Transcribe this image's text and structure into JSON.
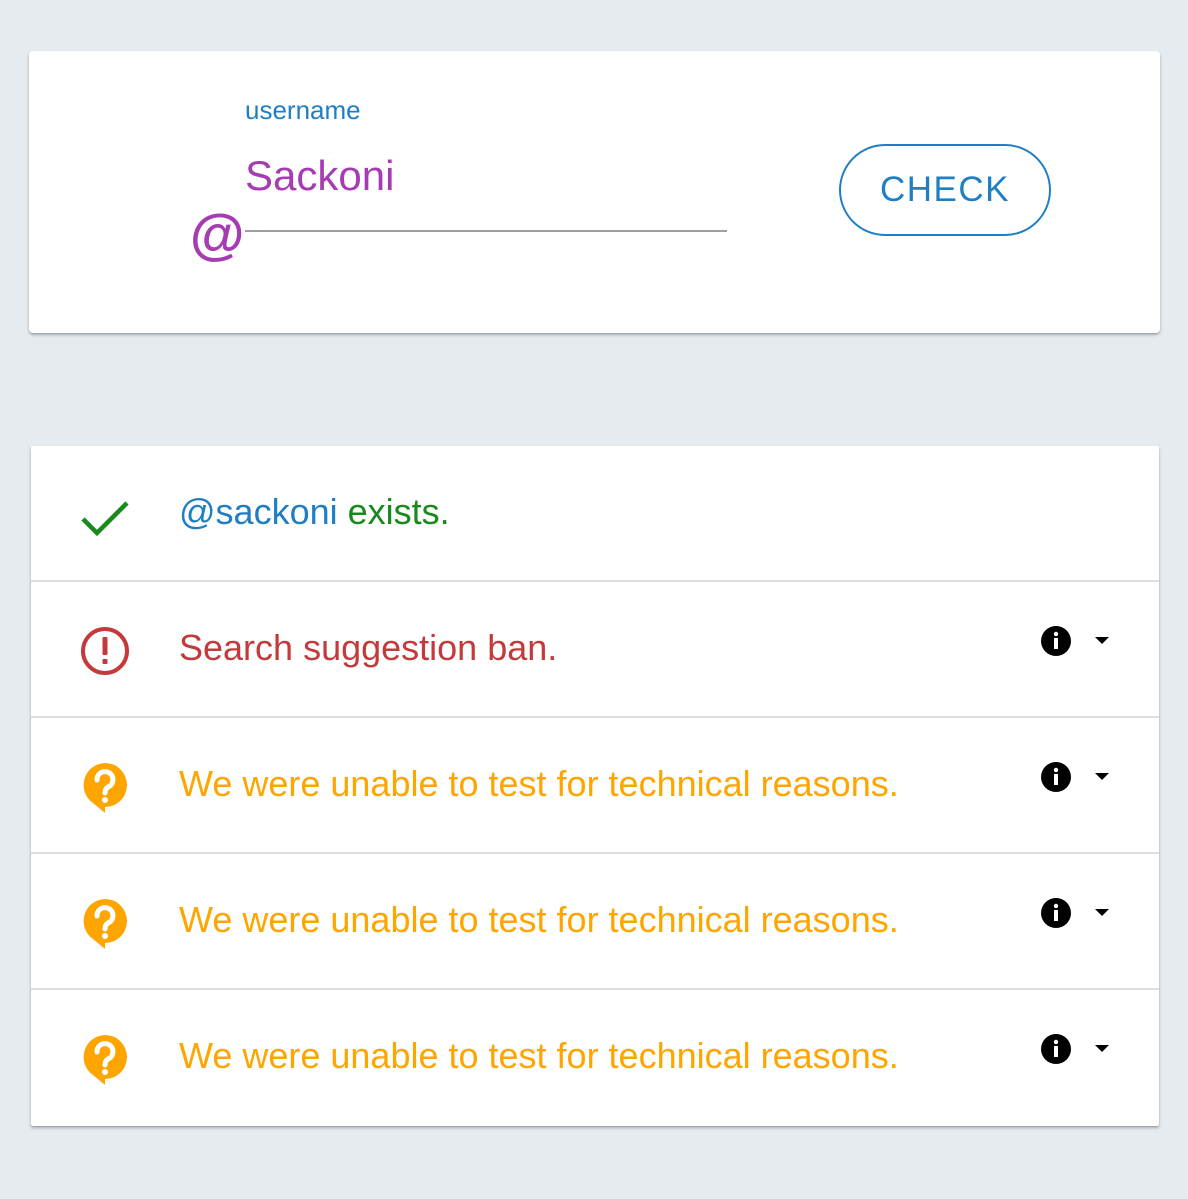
{
  "colors": {
    "background": "#e6ebef",
    "accent_blue": "#1f7fc2",
    "purple": "#a63bb4",
    "success_green": "#18891b",
    "error_red": "#c43a3a",
    "warning_orange": "#ffa500"
  },
  "search": {
    "at_symbol": "@",
    "label": "username",
    "value": "Sackoni",
    "button_label": "CHECK"
  },
  "results": [
    {
      "status": "success",
      "icon": "checkmark-icon",
      "handle": "@sackoni",
      "text": " exists.",
      "expandable": false
    },
    {
      "status": "error",
      "icon": "alert-circle-icon",
      "text": "Search suggestion ban.",
      "expandable": true
    },
    {
      "status": "unknown",
      "icon": "question-bubble-icon",
      "text": "We were unable to test for technical reasons.",
      "expandable": true
    },
    {
      "status": "unknown",
      "icon": "question-bubble-icon",
      "text": "We were unable to test for technical reasons.",
      "expandable": true
    },
    {
      "status": "unknown",
      "icon": "question-bubble-icon",
      "text": "We were unable to test for technical reasons.",
      "expandable": true
    }
  ]
}
